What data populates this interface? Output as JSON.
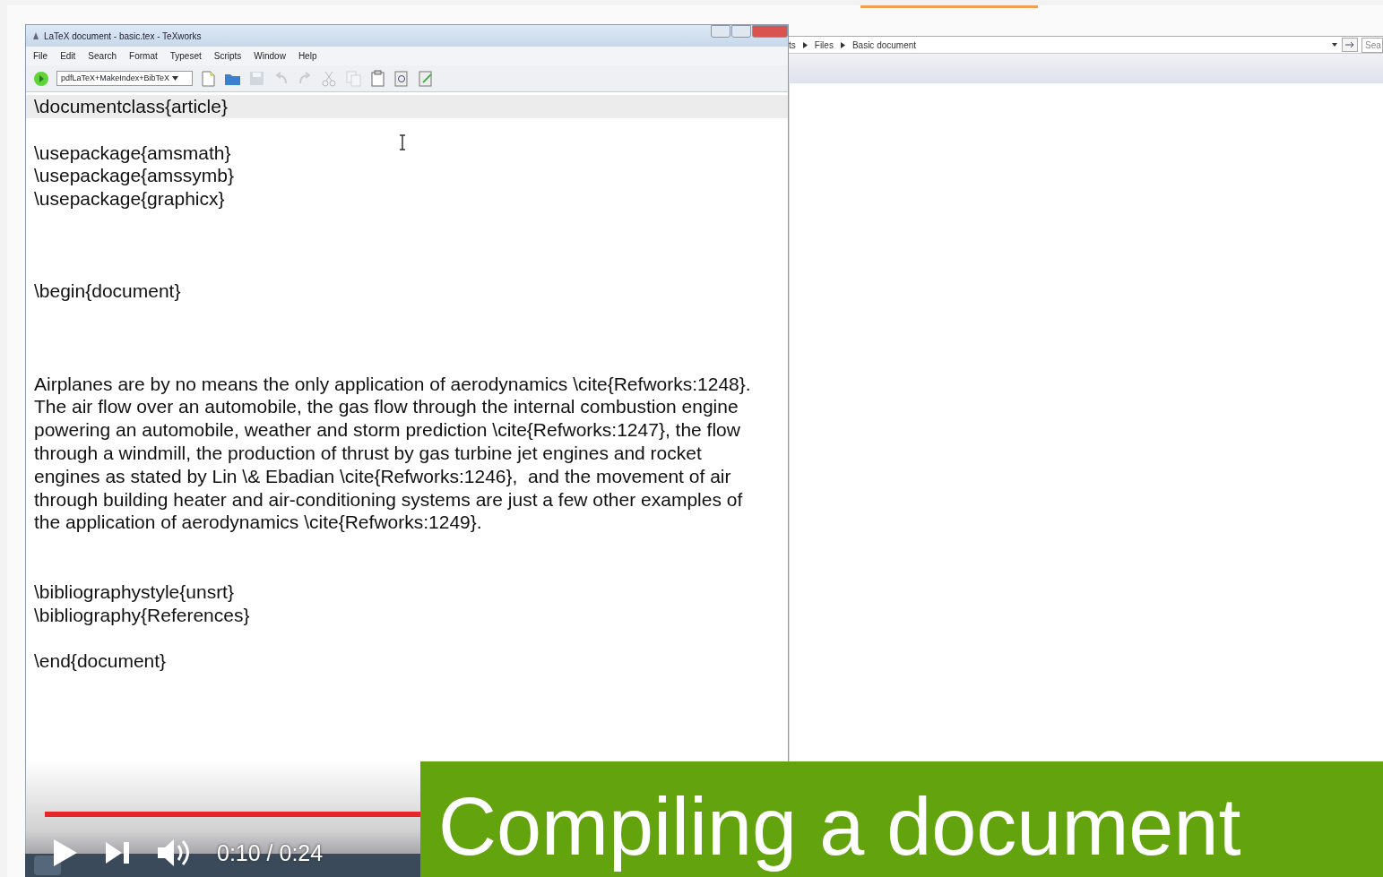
{
  "editor_window": {
    "title": "LaTeX document - basic.tex - TeXworks",
    "menu": [
      "File",
      "Edit",
      "Search",
      "Format",
      "Typeset",
      "Scripts",
      "Window",
      "Help"
    ],
    "typeset_engine": "pdfLaTeX+MakeIndex+BibTeX",
    "toolbar": [
      {
        "kind": "new",
        "disabled": false
      },
      {
        "kind": "open",
        "disabled": false
      },
      {
        "kind": "save",
        "disabled": true
      },
      {
        "kind": "undo",
        "disabled": true
      },
      {
        "kind": "redo",
        "disabled": true
      },
      {
        "kind": "cut",
        "disabled": true
      },
      {
        "kind": "copy",
        "disabled": true
      },
      {
        "kind": "paste",
        "disabled": false
      },
      {
        "kind": "find",
        "disabled": false
      },
      {
        "kind": "replace",
        "disabled": false
      }
    ],
    "lines": [
      {
        "kind": "code",
        "text": "\\documentclass{article}",
        "current": true
      },
      {
        "kind": "blank"
      },
      {
        "kind": "code",
        "text": "\\usepackage{amsmath}",
        "current": false
      },
      {
        "kind": "code",
        "text": "\\usepackage{amssymb}",
        "current": false
      },
      {
        "kind": "code",
        "text": "\\usepackage{graphicx}",
        "current": false
      },
      {
        "kind": "blank"
      },
      {
        "kind": "blank"
      },
      {
        "kind": "blank"
      },
      {
        "kind": "code",
        "text": "\\begin{document}",
        "current": false
      },
      {
        "kind": "blank"
      },
      {
        "kind": "blank"
      },
      {
        "kind": "blank"
      },
      {
        "kind": "code",
        "text": "Airplanes are by no means the only application of aerodynamics \\cite{Refworks:1248}.",
        "current": false
      },
      {
        "kind": "code",
        "text": "The air flow over an automobile, the gas flow through the internal combustion engine",
        "current": false
      },
      {
        "kind": "code",
        "text": "powering an automobile, weather and storm prediction \\cite{Refworks:1247}, the flow",
        "current": false
      },
      {
        "kind": "code",
        "text": "through a windmill, the production of thrust by gas turbine jet engines and rocket",
        "current": false
      },
      {
        "kind": "code",
        "text": "engines as stated by Lin \\& Ebadian \\cite{Refworks:1246},  and the movement of air",
        "current": false
      },
      {
        "kind": "code",
        "text": "through building heater and air-conditioning systems are just a few other examples of",
        "current": false
      },
      {
        "kind": "code",
        "text": "the application of aerodynamics \\cite{Refworks:1249}.",
        "current": false
      },
      {
        "kind": "blank"
      },
      {
        "kind": "blank"
      },
      {
        "kind": "code",
        "text": "\\bibliographystyle{unsrt}",
        "current": false
      },
      {
        "kind": "code",
        "text": "\\bibliography{References}",
        "current": false
      },
      {
        "kind": "blank"
      },
      {
        "kind": "code",
        "text": "\\end{document}",
        "current": false
      }
    ]
  },
  "explorer_window": {
    "breadcrumb": [
      "ts",
      "Files",
      "Basic document"
    ],
    "search_placeholder": "Sea"
  },
  "video_player": {
    "progress": {
      "level": 1
    },
    "time": "0:10 / 0:24"
  },
  "banner": {
    "text": "Compiling a document"
  }
}
